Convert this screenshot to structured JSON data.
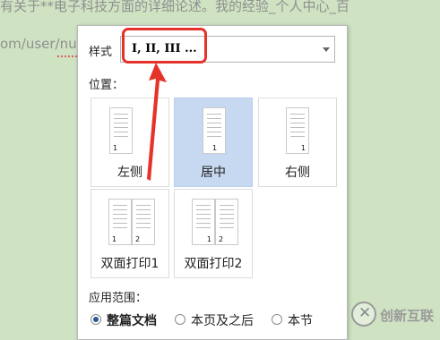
{
  "background": {
    "line1": "有关于**电子科技方面的详细论述。我的经验_个人中心_百",
    "line2": "om/user/nu"
  },
  "panel": {
    "style_label": "样式",
    "style_value": "I, II, III ...",
    "position_label": "位置：",
    "options": [
      {
        "label": "左侧",
        "numbers": [
          "1"
        ]
      },
      {
        "label": "居中",
        "numbers": [
          "1"
        ]
      },
      {
        "label": "右侧",
        "numbers": [
          "1"
        ]
      },
      {
        "label": "双面打印1",
        "numbers": [
          "1",
          "2"
        ]
      },
      {
        "label": "双面打印2",
        "numbers": [
          "1",
          "2"
        ]
      }
    ],
    "selected_position": "居中",
    "scope_label": "应用范围：",
    "scope_options": [
      "整篇文档",
      "本页及之后",
      "本节"
    ],
    "selected_scope": "整篇文档"
  },
  "annotation": {
    "color": "#e5332a"
  },
  "watermark": {
    "text": "创新互联",
    "icon": "logo-circle-x-icon"
  }
}
